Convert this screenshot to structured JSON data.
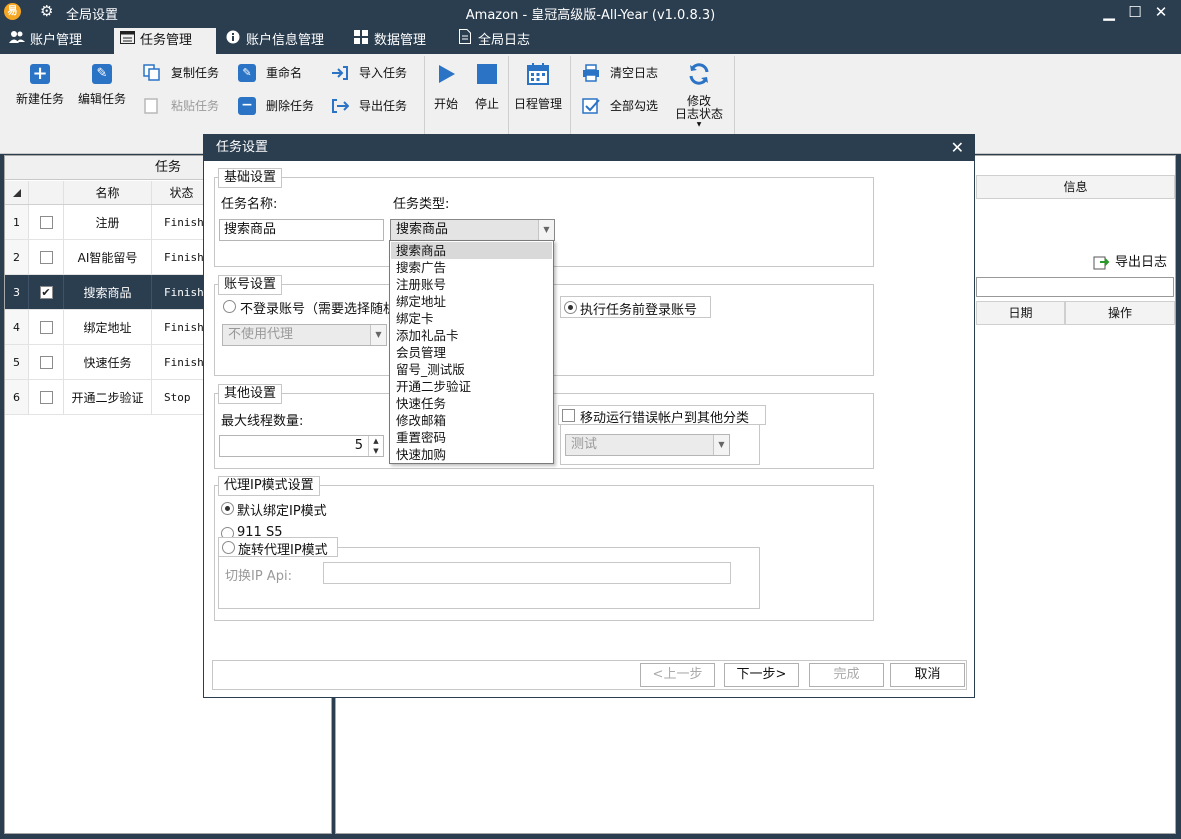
{
  "window": {
    "logo_text": "易",
    "global_settings_label": "全局设置",
    "title": "Amazon - 皇冠高级版-All-Year  (v1.0.8.3)",
    "minimize": "▁",
    "maximize": "☐",
    "close": "✕"
  },
  "tabs": [
    {
      "label": "账户管理",
      "icon": "users-icon"
    },
    {
      "label": "任务管理",
      "icon": "task-window-icon",
      "active": true
    },
    {
      "label": "账户信息管理",
      "icon": "info-icon"
    },
    {
      "label": "数据管理",
      "icon": "grid-icon"
    },
    {
      "label": "全局日志",
      "icon": "document-icon"
    }
  ],
  "ribbon": {
    "new_task": "新建任务",
    "edit_task": "编辑任务",
    "copy_task": "复制任务",
    "paste_task": "粘贴任务",
    "rename": "重命名",
    "delete_task": "删除任务",
    "import_task": "导入任务",
    "export_task": "导出任务",
    "start": "开始",
    "stop": "停止",
    "schedule": "日程管理",
    "clear_log": "清空日志",
    "select_all": "全部勾选",
    "modify_log_status_1": "修改",
    "modify_log_status_2": "日志状态",
    "modify_log_status_caret": "▼"
  },
  "left_panel": {
    "header": "任务",
    "columns": [
      "名称",
      "状态"
    ],
    "rows": [
      {
        "num": "1",
        "checked": false,
        "name": "注册",
        "status": "Finished"
      },
      {
        "num": "2",
        "checked": false,
        "name": "AI智能留号",
        "status": "Finished"
      },
      {
        "num": "3",
        "checked": true,
        "name": "搜索商品",
        "status": "Finished",
        "selected": true
      },
      {
        "num": "4",
        "checked": false,
        "name": "绑定地址",
        "status": "Finished"
      },
      {
        "num": "5",
        "checked": false,
        "name": "快速任务",
        "status": "Finished"
      },
      {
        "num": "6",
        "checked": false,
        "name": "开通二步验证",
        "status": "Stop"
      }
    ]
  },
  "right_panel": {
    "info_header": "信息",
    "export_log": "导出日志",
    "date_header": "日期",
    "action_header": "操作"
  },
  "dialog": {
    "title": "任务设置",
    "close": "✕",
    "basic_group": "基础设置",
    "task_name_label": "任务名称:",
    "task_name_value": "搜索商品",
    "task_type_label": "任务类型:",
    "task_type_value": "搜索商品",
    "task_type_options": [
      "搜索商品",
      "搜索广告",
      "注册账号",
      "绑定地址",
      "绑定卡",
      "添加礼品卡",
      "会员管理",
      "留号_测试版",
      "开通二步验证",
      "快速任务",
      "修改邮箱",
      "重置密码",
      "快速加购"
    ],
    "task_type_selected_index": 0,
    "account_group": "账号设置",
    "no_login_label": "不登录账号（需要选择随机",
    "proxy_select_value": "不使用代理",
    "login_before_label": "执行任务前登录账号",
    "other_group": "其他设置",
    "max_threads_label": "最大线程数量:",
    "max_threads_value": "5",
    "move_error_label": "移动运行错误帐户到其他分类",
    "category_select_value": "测试",
    "proxy_group": "代理IP模式设置",
    "proxy_default_label": "默认绑定IP模式",
    "proxy_911_label": "911 S5",
    "proxy_rotate_label": "旋转代理IP模式",
    "switch_ip_label": "切换IP Api:",
    "switch_ip_value": "",
    "btn_prev": "<上一步",
    "btn_next": "下一步>",
    "btn_finish": "完成",
    "btn_cancel": "取消"
  }
}
